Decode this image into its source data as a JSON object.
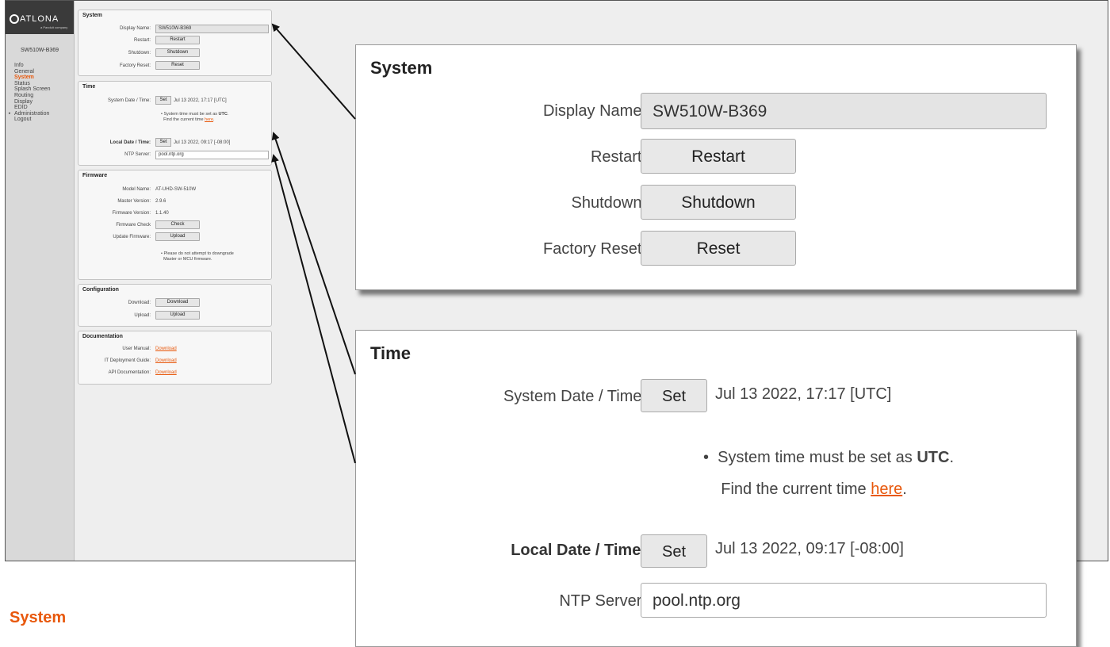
{
  "sidebar": {
    "logo_text": "ATLONA",
    "logo_sub": "a Panduit company",
    "device_name": "SW510W-B369",
    "items": [
      {
        "label": "Info"
      },
      {
        "label": "General"
      },
      {
        "label": "System"
      },
      {
        "label": "Status"
      },
      {
        "label": "Splash Screen"
      },
      {
        "label": "Routing"
      },
      {
        "label": "Display"
      },
      {
        "label": "EDID"
      },
      {
        "label": "Administration"
      },
      {
        "label": "Logout"
      }
    ]
  },
  "system": {
    "title": "System",
    "display_name_label": "Display Name:",
    "display_name_value": "SW510W-B369",
    "restart_label": "Restart:",
    "restart_button": "Restart",
    "shutdown_label": "Shutdown:",
    "shutdown_button": "Shutdown",
    "factory_reset_label": "Factory Reset:",
    "reset_button": "Reset"
  },
  "time": {
    "title": "Time",
    "system_dt_label": "System Date / Time:",
    "set_button": "Set",
    "system_dt_value": "Jul 13 2022, 17:17 [UTC]",
    "note_line1_prefix": "System time must be set as ",
    "note_line1_bold": "UTC",
    "note_line1_suffix": ".",
    "note_line2_prefix": "Find the current time ",
    "note_link": "here",
    "note_line2_suffix": ".",
    "local_dt_label": "Local Date / Time:",
    "local_dt_value": "Jul 13 2022, 09:17 [-08:00]",
    "ntp_label": "NTP Server:",
    "ntp_value": "pool.ntp.org"
  },
  "firmware": {
    "title": "Firmware",
    "model_label": "Model Name:",
    "model_value": "AT-UHD-SW-510W",
    "master_label": "Master Version:",
    "master_value": "2.9.6",
    "fw_label": "Firmware Version:",
    "fw_value": "1.1.40",
    "check_label": "Firmware Check",
    "check_button": "Check",
    "update_label": "Update Firmware:",
    "upload_button": "Upload",
    "note_line1": "Please do not attempt to downgrade",
    "note_line2": "Master or MCU firmware."
  },
  "configuration": {
    "title": "Configuration",
    "download_label": "Download:",
    "download_button": "Download",
    "upload_label": "Upload:",
    "upload_button": "Upload"
  },
  "documentation": {
    "title": "Documentation",
    "user_manual_label": "User Manual:",
    "it_guide_label": "IT Deployment Guide:",
    "api_label": "API Documentation:",
    "link_text": "Download"
  },
  "page_heading": "System",
  "colors": {
    "accent": "#e8580c",
    "sidebar_bg": "#d9d9d9",
    "logo_bg": "#3a3a3a",
    "content_bg": "#eeeeee"
  }
}
